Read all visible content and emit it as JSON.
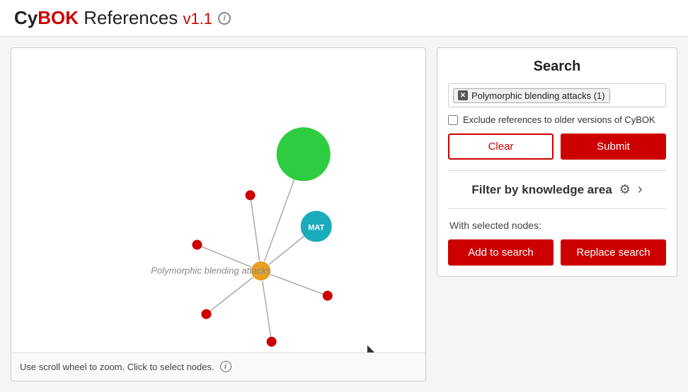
{
  "header": {
    "brand_cy": "Cy",
    "brand_bok": "BOK",
    "brand_ref": " References",
    "version": "v1.1",
    "info_tooltip": "Information"
  },
  "graph": {
    "footer_text": "Use scroll wheel to zoom. Click to select nodes.",
    "info_tooltip": "Information"
  },
  "search": {
    "title": "Search",
    "tag_text": "Polymorphic blending attacks (1)",
    "checkbox_label": "Exclude references to older versions of CyBOK",
    "clear_label": "Clear",
    "submit_label": "Submit",
    "filter_label": "Filter by knowledge area",
    "selected_nodes_label": "With selected nodes:",
    "add_label": "Add to search",
    "replace_label": "Replace search"
  },
  "nodes": {
    "center_label": "Polymorphic blending attacks",
    "mat_label": "MAT"
  }
}
